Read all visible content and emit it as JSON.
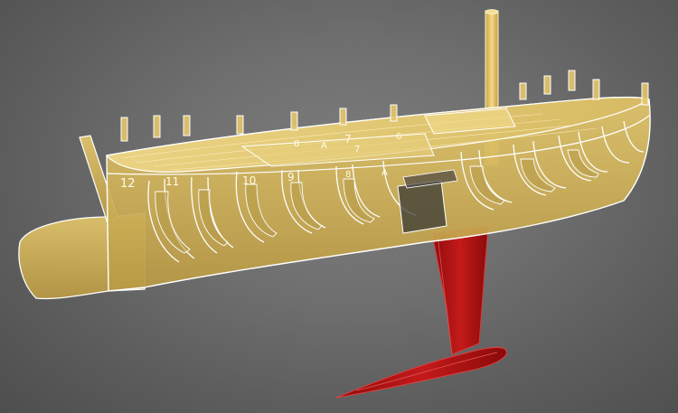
{
  "viewport": {
    "background": "#6e6e6e",
    "hull_color": "#d8b95a",
    "hull_edge_color": "#ffffff",
    "keel_color": "#b01010",
    "mast_color": "#e8c76a"
  },
  "frame_labels": [
    "12",
    "11",
    "10",
    "9",
    "8",
    "A",
    "7",
    "6",
    "8",
    "A",
    "7"
  ]
}
